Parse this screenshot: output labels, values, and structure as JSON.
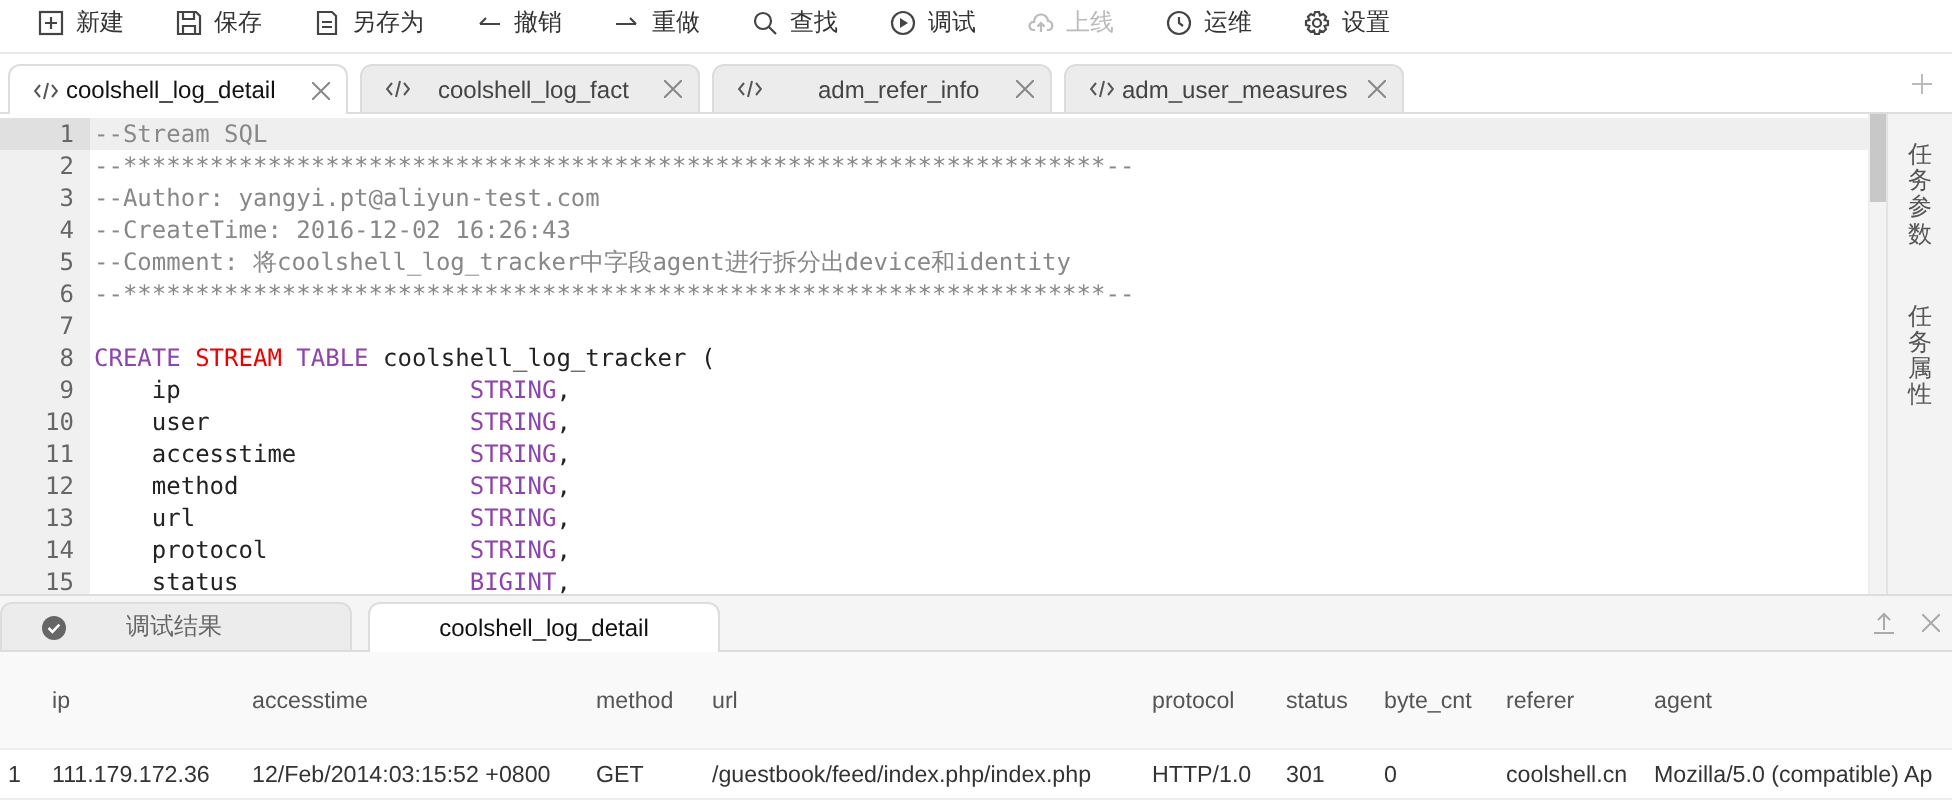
{
  "toolbar": [
    {
      "label": "新建",
      "disabled": false
    },
    {
      "label": "保存",
      "disabled": false
    },
    {
      "label": "另存为",
      "disabled": false
    },
    {
      "label": "撤销",
      "disabled": false
    },
    {
      "label": "重做",
      "disabled": false
    },
    {
      "label": "查找",
      "disabled": false
    },
    {
      "label": "调试",
      "disabled": false
    },
    {
      "label": "上线",
      "disabled": true
    },
    {
      "label": "运维",
      "disabled": false
    },
    {
      "label": "设置",
      "disabled": false
    }
  ],
  "tabs": [
    {
      "label": "coolshell_log_detail",
      "selected": true
    },
    {
      "label": "coolshell_log_fact",
      "selected": false
    },
    {
      "label": "adm_refer_info",
      "selected": false
    },
    {
      "label": "adm_user_measures",
      "selected": false
    }
  ],
  "editor": {
    "lines": [
      {
        "number": "1",
        "selected": true,
        "segments": [
          {
            "kind": "comment",
            "text": "--Stream SQL"
          }
        ]
      },
      {
        "number": "2",
        "selected": false,
        "segments": [
          {
            "kind": "comment",
            "text": "--********************************************************************--"
          }
        ]
      },
      {
        "number": "3",
        "selected": false,
        "segments": [
          {
            "kind": "comment",
            "text": "--Author: yangyi.pt@aliyun-test.com"
          }
        ]
      },
      {
        "number": "4",
        "selected": false,
        "segments": [
          {
            "kind": "comment",
            "text": "--CreateTime: 2016-12-02 16:26:43"
          }
        ]
      },
      {
        "number": "5",
        "selected": false,
        "segments": [
          {
            "kind": "comment",
            "text": "--Comment: 将coolshell_log_tracker中字段agent进行拆分出device和identity"
          }
        ]
      },
      {
        "number": "6",
        "selected": false,
        "segments": [
          {
            "kind": "comment",
            "text": "--********************************************************************--"
          }
        ]
      },
      {
        "number": "7",
        "selected": false
      },
      {
        "number": "8",
        "selected": false,
        "segments": [
          {
            "kind": "keyword",
            "text": "CREATE "
          },
          {
            "kind": "stream",
            "text": "STREAM "
          },
          {
            "kind": "keyword",
            "text": "TABLE"
          },
          {
            "kind": "plain",
            "text": " coolshell_log_tracker ("
          }
        ]
      },
      {
        "number": "9",
        "selected": false,
        "segments": [
          {
            "kind": "plain",
            "text": "    ip                    "
          },
          {
            "kind": "type",
            "text": "STRING"
          },
          {
            "kind": "plain",
            "text": ","
          }
        ]
      },
      {
        "number": "10",
        "selected": false,
        "segments": [
          {
            "kind": "plain",
            "text": "    user                  "
          },
          {
            "kind": "type",
            "text": "STRING"
          },
          {
            "kind": "plain",
            "text": ","
          }
        ]
      },
      {
        "number": "11",
        "selected": false,
        "segments": [
          {
            "kind": "plain",
            "text": "    accesstime            "
          },
          {
            "kind": "type",
            "text": "STRING"
          },
          {
            "kind": "plain",
            "text": ","
          }
        ]
      },
      {
        "number": "12",
        "selected": false,
        "segments": [
          {
            "kind": "plain",
            "text": "    method                "
          },
          {
            "kind": "type",
            "text": "STRING"
          },
          {
            "kind": "plain",
            "text": ","
          }
        ]
      },
      {
        "number": "13",
        "selected": false,
        "segments": [
          {
            "kind": "plain",
            "text": "    url                   "
          },
          {
            "kind": "type",
            "text": "STRING"
          },
          {
            "kind": "plain",
            "text": ","
          }
        ]
      },
      {
        "number": "14",
        "selected": false,
        "segments": [
          {
            "kind": "plain",
            "text": "    protocol              "
          },
          {
            "kind": "type",
            "text": "STRING"
          },
          {
            "kind": "plain",
            "text": ","
          }
        ]
      },
      {
        "number": "15",
        "selected": false,
        "segments": [
          {
            "kind": "plain",
            "text": "    status                "
          },
          {
            "kind": "type",
            "text": "BIGINT"
          },
          {
            "kind": "plain",
            "text": ","
          }
        ]
      }
    ]
  },
  "side_panel": [
    "任务参数",
    "任务属性"
  ],
  "result_tabs": [
    {
      "label": "调试结果",
      "selected": false
    },
    {
      "label": "coolshell_log_detail",
      "selected": true
    }
  ],
  "table": {
    "columns": [
      "ip",
      "accesstime",
      "method",
      "url",
      "protocol",
      "status",
      "byte_cnt",
      "referer",
      "agent"
    ],
    "rows": [
      {
        "number": "1",
        "cells": [
          "111.179.172.36",
          "12/Feb/2014:03:15:52 +0800",
          "GET",
          "/guestbook/feed/index.php/index.php",
          "HTTP/1.0",
          "301",
          "0",
          "coolshell.cn",
          "Mozilla/5.0 (compatible) Ap"
        ]
      }
    ]
  }
}
